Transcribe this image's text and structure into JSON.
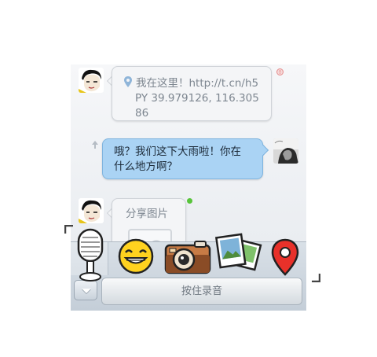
{
  "messages": [
    {
      "direction": "incoming",
      "type": "location",
      "line1": "我在这里！http://t.cn/h5",
      "line2": "PY 39.979126, 116.305",
      "line3": "86",
      "status": "failed"
    },
    {
      "direction": "outgoing",
      "type": "text",
      "line1": "哦？我们这下大雨啦！你在",
      "line2": "什么地方啊？"
    },
    {
      "direction": "incoming",
      "type": "image",
      "label": "分享图片",
      "status": "online"
    }
  ],
  "toolbar": {
    "icons": [
      "microphone-icon",
      "smiley-icon",
      "camera-icon",
      "photos-icon",
      "location-pin-icon"
    ],
    "record_label": "按住录音"
  },
  "colors": {
    "outgoing_bubble": "#aad3f4",
    "incoming_bubble": "#f4f5f7",
    "online_dot": "#58c43b",
    "location_pin": "#e8312a"
  }
}
